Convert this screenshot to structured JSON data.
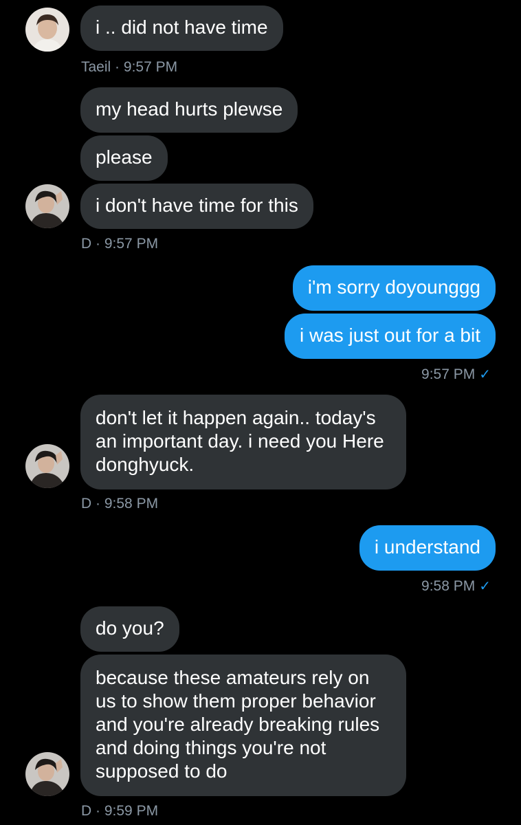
{
  "conversation": {
    "messages": [
      {
        "text": "i .. did not have time"
      },
      {
        "text": "my head hurts plewse"
      },
      {
        "text": "please"
      },
      {
        "text": "i don't have time for this"
      },
      {
        "text": "i'm sorry doyounggg"
      },
      {
        "text": "i was just out for a bit"
      },
      {
        "text": "don't let it happen again.. today's an important day. i need you Here donghyuck."
      },
      {
        "text": "i understand"
      },
      {
        "text": "do you?"
      },
      {
        "text": "because these amateurs rely on us to show them proper behavior and you're already breaking rules and doing things you're not supposed to do"
      }
    ],
    "meta": [
      {
        "sender": "Taeil",
        "time": "9:57 PM"
      },
      {
        "sender": "D",
        "time": "9:57 PM"
      },
      {
        "time": "9:57 PM"
      },
      {
        "sender": "D",
        "time": "9:58 PM"
      },
      {
        "time": "9:58 PM"
      },
      {
        "sender": "D",
        "time": "9:59 PM"
      }
    ],
    "separator": "·",
    "read_receipt_icon": "✓"
  },
  "avatars": [
    {
      "name": "Taeil",
      "icon": "avatar-taeil"
    },
    {
      "name": "D",
      "icon": "avatar-d"
    }
  ],
  "colors": {
    "background": "#000000",
    "incoming_bubble": "#2f3336",
    "outgoing_bubble": "#1d9bf0",
    "meta_text": "#8b98a5"
  }
}
